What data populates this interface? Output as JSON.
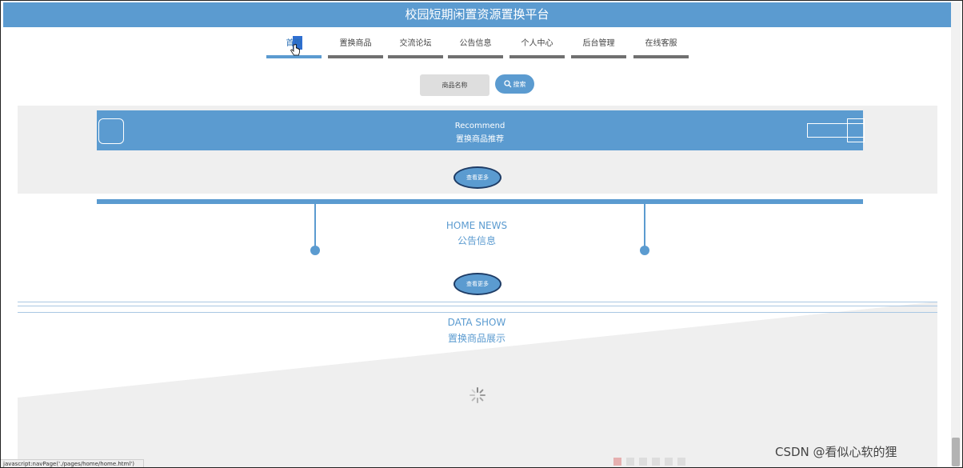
{
  "header": {
    "title": "校园短期闲置资源置换平台"
  },
  "nav": {
    "items": [
      {
        "label": "首页",
        "active": true
      },
      {
        "label": "置换商品",
        "active": false
      },
      {
        "label": "交流论坛",
        "active": false
      },
      {
        "label": "公告信息",
        "active": false
      },
      {
        "label": "个人中心",
        "active": false
      },
      {
        "label": "后台管理",
        "active": false
      },
      {
        "label": "在线客服",
        "active": false
      }
    ]
  },
  "search": {
    "placeholder": "商品名称",
    "button_label": "搜索",
    "button_icon": "search-icon"
  },
  "recommend": {
    "en_title": "Recommend",
    "cn_title": "置换商品推荐",
    "more_label": "查看更多"
  },
  "news": {
    "en_title": "HOME NEWS",
    "cn_title": "公告信息",
    "more_label": "查看更多"
  },
  "data_show": {
    "en_title": "DATA SHOW",
    "cn_title": "置换商品展示"
  },
  "status_bar": {
    "text": "javascript:navPage('./pages/home/home.html')"
  },
  "watermark": {
    "text": "CSDN @看似心软的狸"
  },
  "colors": {
    "accent": "#5b9bd0",
    "nav_bar": "#707070",
    "panel_bg": "#efefef"
  }
}
